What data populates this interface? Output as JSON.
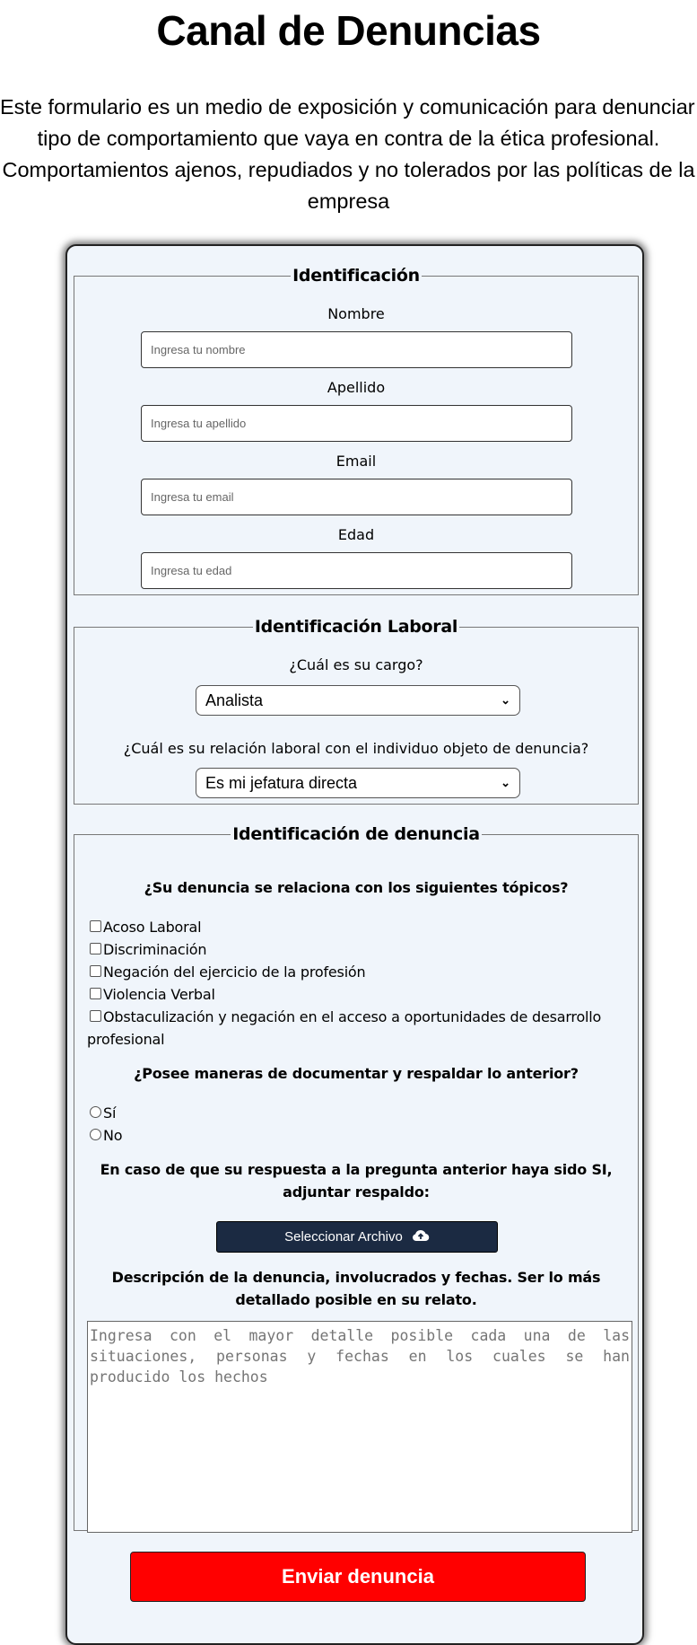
{
  "page": {
    "title": "Canal de Denuncias",
    "intro_lines": [
      "Este formulario es un medio de exposición y comunicación para denunciar todo",
      "tipo de comportamiento que vaya en contra de la ética profesional.",
      "Comportamientos ajenos, repudiados y no tolerados por las políticas de la",
      "empresa"
    ]
  },
  "identificacion": {
    "legend": "Identificación",
    "nombre": {
      "label": "Nombre",
      "placeholder": "Ingresa tu nombre",
      "value": ""
    },
    "apellido": {
      "label": "Apellido",
      "placeholder": "Ingresa tu apellido",
      "value": ""
    },
    "email": {
      "label": "Email",
      "placeholder": "Ingresa tu email",
      "value": ""
    },
    "edad": {
      "label": "Edad",
      "placeholder": "Ingresa tu edad",
      "value": ""
    }
  },
  "laboral": {
    "legend": "Identificación Laboral",
    "cargo": {
      "label": "¿Cuál es su cargo?",
      "selected": "Analista"
    },
    "relacion": {
      "label": "¿Cuál es su relación laboral con el individuo objeto de denuncia?",
      "selected": "Es mi jefatura directa"
    }
  },
  "denuncia": {
    "legend": "Identificación de denuncia",
    "topicos_question": "¿Su denuncia se relaciona con los siguientes tópicos?",
    "topicos": [
      {
        "label": "Acoso Laboral",
        "checked": false
      },
      {
        "label": "Discriminación",
        "checked": false
      },
      {
        "label": "Negación del ejercicio de la profesión",
        "checked": false
      },
      {
        "label": "Violencia Verbal",
        "checked": false
      },
      {
        "label": "Obstaculización y negación en el acceso a oportunidades de desarrollo profesional",
        "checked": false
      }
    ],
    "respaldo_question": "¿Posee maneras de documentar y respaldar lo anterior?",
    "respaldo_options": [
      {
        "label": "Sí",
        "selected": false
      },
      {
        "label": "No",
        "selected": false
      }
    ],
    "adjuntar_text": "En caso de que su respuesta a la pregunta anterior haya sido SI, adjuntar respaldo:",
    "file_button": "Seleccionar Archivo",
    "upload_icon": "cloud-upload-icon",
    "descripcion_text": "Descripción de la denuncia, involucrados y fechas. Ser lo más detallado posible en su relato.",
    "descripcion_placeholder": "Ingresa con el mayor detalle posible cada una de las situaciones, personas y fechas en los cuales se han producido los hechos",
    "descripcion_value": ""
  },
  "submit_label": "Enviar denuncia",
  "colors": {
    "card_bg": "#f0f5fb",
    "file_button_bg": "#1b2a42",
    "submit_bg": "#ff0000"
  }
}
